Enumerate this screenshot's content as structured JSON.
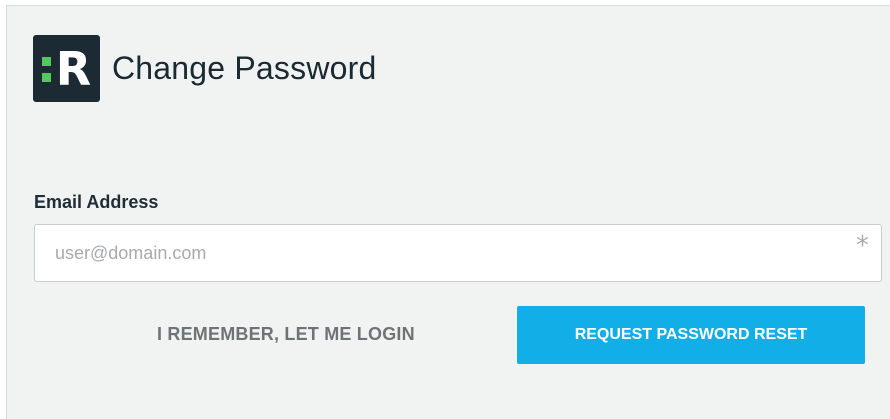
{
  "header": {
    "logo_letter": "R",
    "title": "Change Password"
  },
  "form": {
    "email_label": "Email Address",
    "email_value": "",
    "email_placeholder": "user@domain.com",
    "required_marker": "*"
  },
  "actions": {
    "login_link_label": "I REMEMBER, LET ME LOGIN",
    "reset_button_label": "REQUEST PASSWORD RESET"
  },
  "colors": {
    "accent": "#12aee8",
    "logo_bg": "#1c2a33",
    "logo_dots": "#4ecb5a",
    "panel_bg": "#f1f2f2"
  }
}
